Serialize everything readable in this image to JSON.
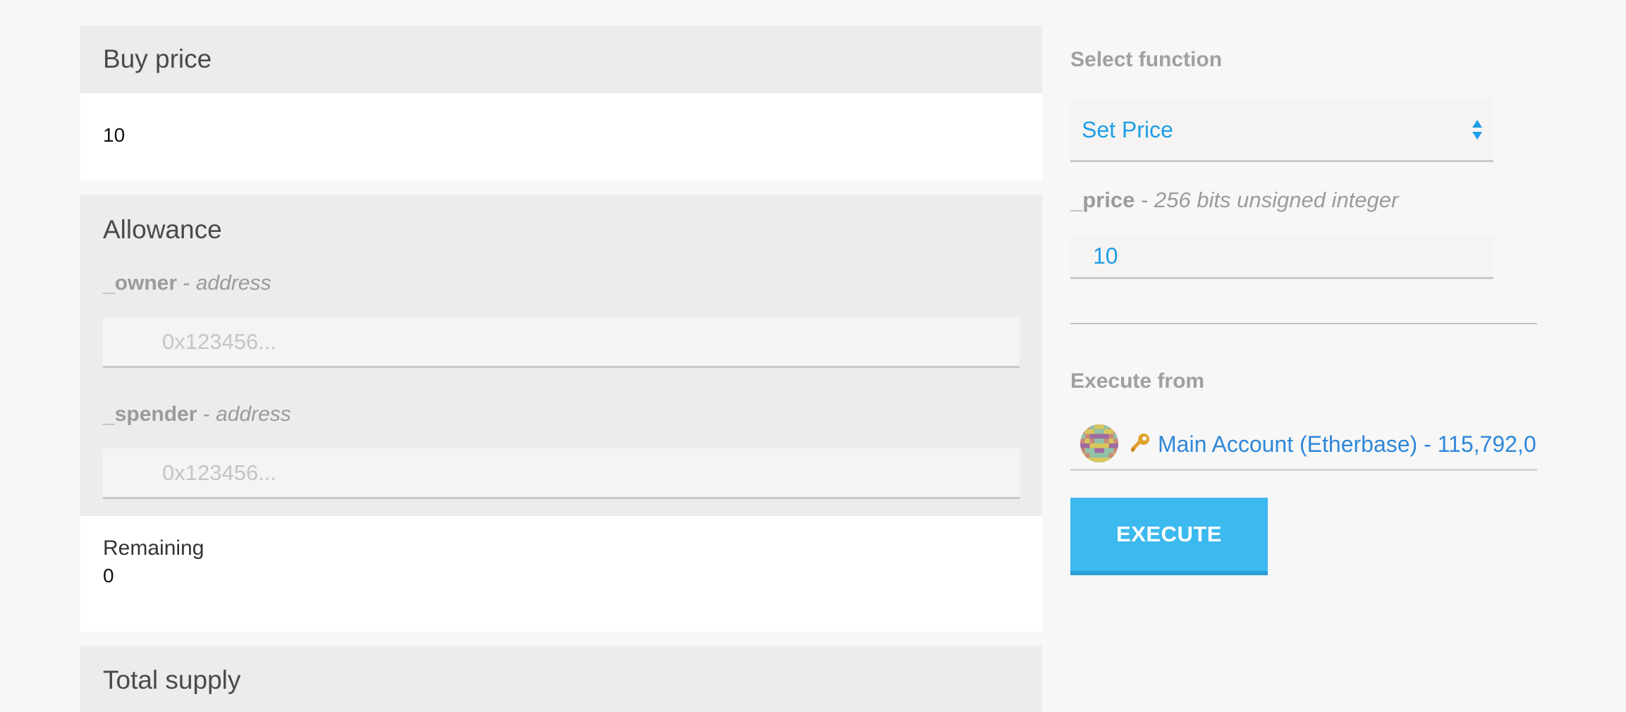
{
  "left": {
    "buy_price": {
      "title": "Buy price",
      "value": "10"
    },
    "allowance": {
      "title": "Allowance",
      "params": [
        {
          "prefix": "_",
          "name": "owner",
          "dash": " - ",
          "type": "address",
          "placeholder": "0x123456..."
        },
        {
          "prefix": "_",
          "name": "spender",
          "dash": " - ",
          "type": "address",
          "placeholder": "0x123456..."
        }
      ],
      "result_label": "Remaining",
      "result_value": "0"
    },
    "total_supply": {
      "title": "Total supply"
    }
  },
  "right": {
    "select_function_label": "Select function",
    "selected_function": "Set Price",
    "param": {
      "prefix": "_",
      "name": "price",
      "dash": " - ",
      "type": "256 bits unsigned integer",
      "value": "10"
    },
    "execute_from_label": "Execute from",
    "account": {
      "text": "Main Account (Etherbase) - 115,792,0",
      "avatar_icon": "identicon-avatar",
      "key_icon": "key-icon"
    },
    "execute_label": "EXECUTE"
  },
  "colors": {
    "accent": "#1e9ee6",
    "button": "#3cb9ee",
    "card_header": "#edebeb",
    "account_link": "#2f87d8"
  }
}
